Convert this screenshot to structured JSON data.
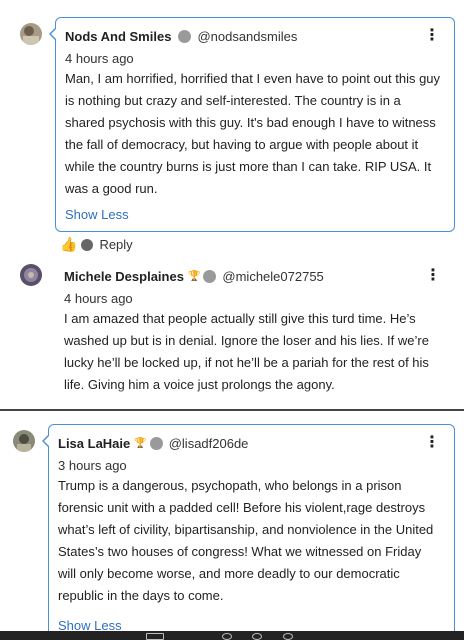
{
  "comments": [
    {
      "username": "Nods And Smiles",
      "handle": "@nodsandsmiles",
      "time": "4 hours ago",
      "text": "Man, I am horrified, horrified that I even have to point out this guy is nothing but crazy and self-interested. The country is in a shared psychosis with this guy. It's bad enough I have to witness the fall of democracy, but having to argue with people about it while the country burns is just more than I can take. RIP USA. It was a good run.",
      "show_less": "Show Less",
      "menu_icon": "more-vert-icon"
    },
    {
      "username": "Michele Desplaines",
      "handle": "@michele072755",
      "time": "4 hours ago",
      "text": "I am amazed that people actually still give this turd time. He’s washed up but is in denial. Ignore the loser and his lies. If we’re lucky he’ll be locked up, if not he’ll be a pariah for the rest of his life. Giving him a voice just prolongs the agony.",
      "badge_icon": "trophy-icon",
      "menu_icon": "more-vert-icon"
    },
    {
      "username": "Lisa LaHaie",
      "handle": "@lisadf206de",
      "time": "3 hours ago",
      "text": "Trump is a dangerous, psychopath, who belongs in a prison forensic unit with a padded cell! Before his violent,rage destroys what’s left of civility, bipartisanship, and nonviolence in the United States’s two houses of congress! What we witnessed on Friday will only become worse, and more deadly to our democratic republic in the days to come.",
      "show_less": "Show Less",
      "badge_icon": "trophy-icon",
      "menu_icon": "more-vert-icon"
    }
  ],
  "actions": {
    "reply_label": "Reply",
    "like_icon": "thumbs-up-icon"
  },
  "colors": {
    "card_border": "#4a90d9",
    "link": "#2f6fc0",
    "badge_gray": "#9a9a9a",
    "trophy": "#e0a100"
  }
}
